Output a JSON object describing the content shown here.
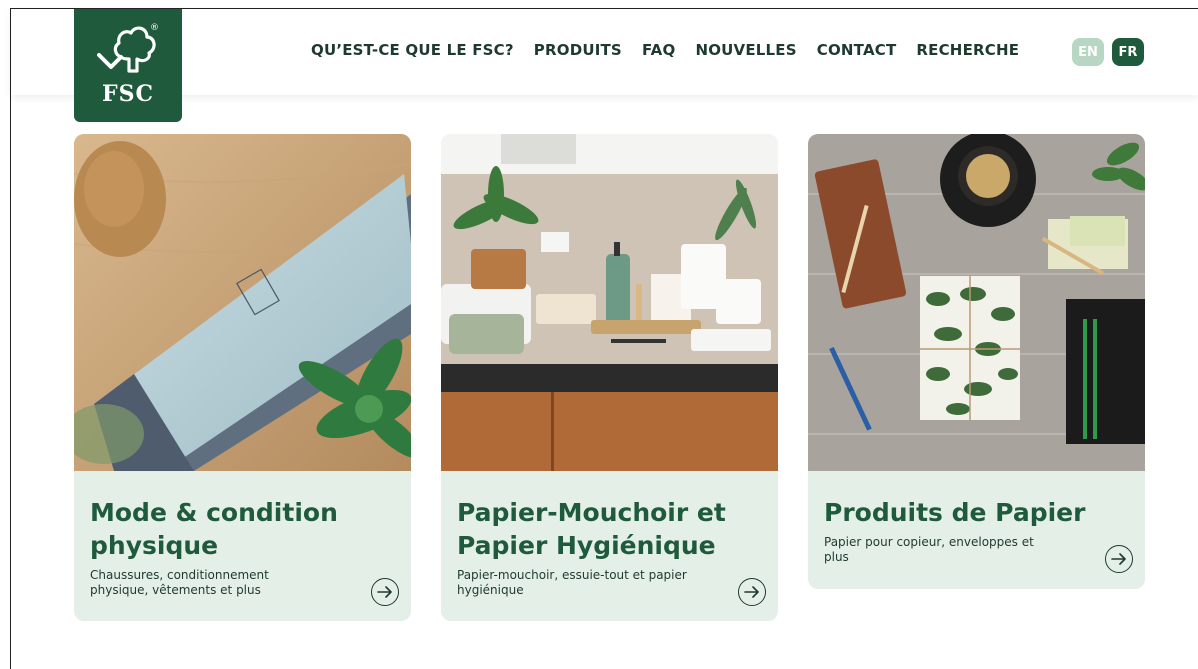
{
  "brand": {
    "logo_text": "FSC",
    "registered_mark": "®",
    "logo_color": "#1e5a3b"
  },
  "nav": {
    "items": [
      {
        "label": "QU’EST-CE QUE LE FSC?"
      },
      {
        "label": "PRODUITS"
      },
      {
        "label": "FAQ"
      },
      {
        "label": "NOUVELLES"
      },
      {
        "label": "CONTACT"
      },
      {
        "label": "RECHERCHE"
      }
    ]
  },
  "languages": {
    "en": "EN",
    "fr": "FR",
    "active": "FR"
  },
  "cards": [
    {
      "title_line1": "Mode & condition",
      "title_line2": "physique",
      "desc_line1": "Chaussures, conditionnement",
      "desc_line2": "physique, vêtements et plus",
      "image": "packaging-tube-succulent-photo",
      "icon": "arrow-right-icon"
    },
    {
      "title_line1": "Papier-Mouchoir et",
      "title_line2": "Papier Hygiénique",
      "desc_line1": "Papier-mouchoir, essuie-tout et papier",
      "desc_line2": "hygiénique",
      "image": "bathroom-sink-plants-photo",
      "icon": "arrow-right-icon"
    },
    {
      "title_line1": "Produits de Papier",
      "title_line2": "",
      "desc_line1": "Papier pour copieur, enveloppes et",
      "desc_line2": "plus",
      "image": "desk-notebooks-coffee-photo",
      "icon": "arrow-right-icon"
    }
  ],
  "colors": {
    "accent": "#1e5a3b",
    "card_bg": "#e4efe8",
    "lang_inactive": "#b8d6c4"
  }
}
